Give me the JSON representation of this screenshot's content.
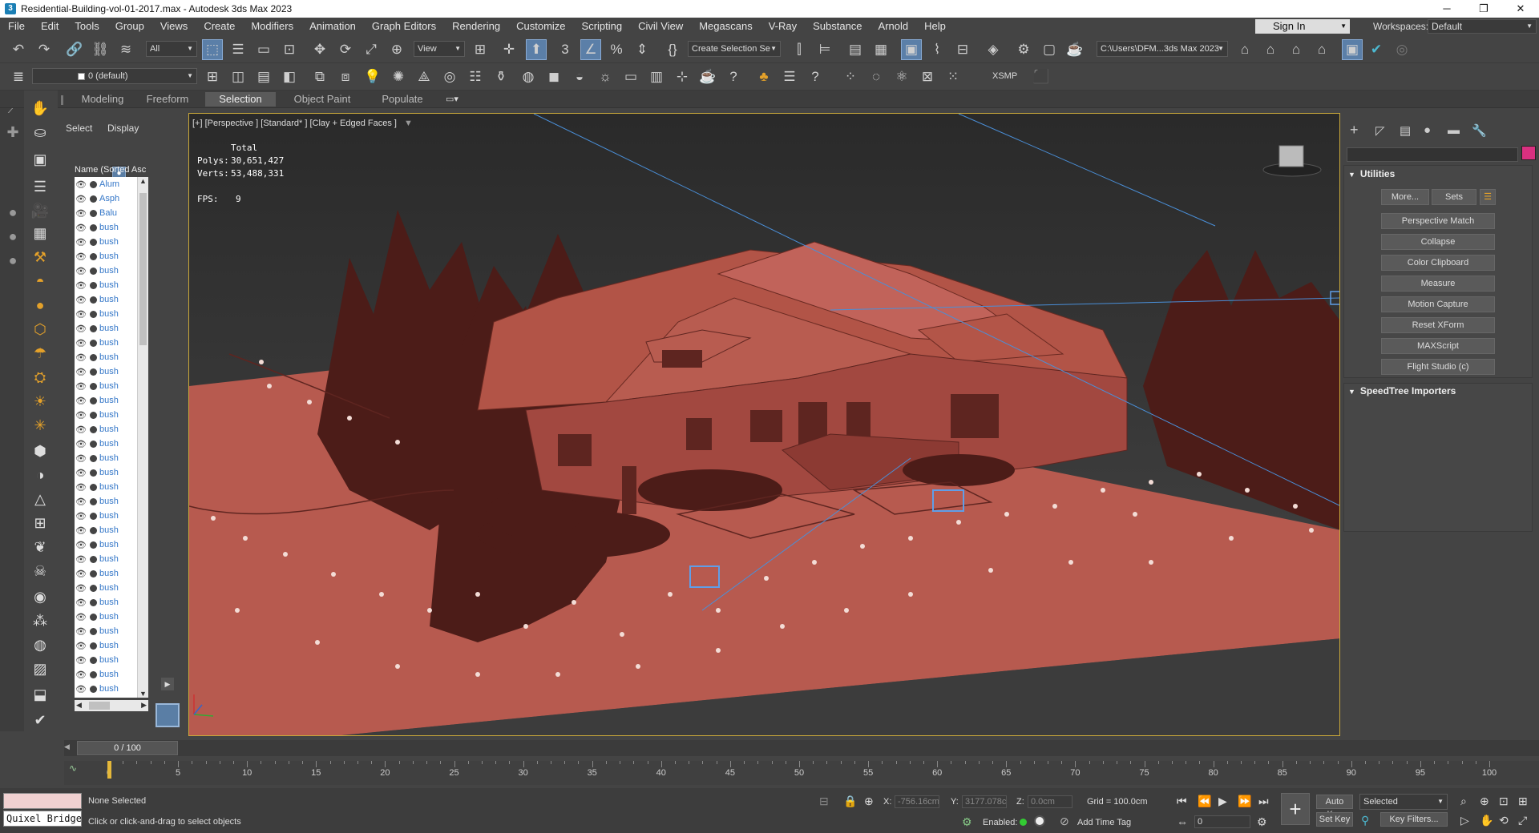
{
  "window": {
    "title": "Residential-Building-vol-01-2017.max - Autodesk 3ds Max 2023"
  },
  "menu": [
    "File",
    "Edit",
    "Tools",
    "Group",
    "Views",
    "Create",
    "Modifiers",
    "Animation",
    "Graph Editors",
    "Rendering",
    "Customize",
    "Scripting",
    "Civil View",
    "Megascans",
    "V-Ray",
    "Substance",
    "Arnold",
    "Help"
  ],
  "account": {
    "sign_in": "Sign In",
    "workspaces_label": "Workspaces:",
    "workspace_value": "Default"
  },
  "toolbar": {
    "selection_filter": "All",
    "reference_coord": "View",
    "selection_set": "Create Selection Se",
    "project_path": "C:\\Users\\DFM...3ds Max 2023",
    "layer": "0 (default)",
    "xsmp": "XSMP"
  },
  "ribbon_tabs": [
    "Modeling",
    "Freeform",
    "Selection",
    "Object Paint",
    "Populate"
  ],
  "explorer": {
    "tab_select": "Select",
    "tab_display": "Display",
    "column_header": "Name (Sorted Asc",
    "items": [
      "Alum",
      "Asph",
      "Balu",
      "bush",
      "bush",
      "bush",
      "bush",
      "bush",
      "bush",
      "bush",
      "bush",
      "bush",
      "bush",
      "bush",
      "bush",
      "bush",
      "bush",
      "bush",
      "bush",
      "bush",
      "bush",
      "bush",
      "bush",
      "bush",
      "bush",
      "bush",
      "bush",
      "bush",
      "bush",
      "bush",
      "bush",
      "bush",
      "bush",
      "bush",
      "bush",
      "bush"
    ]
  },
  "viewport": {
    "label": "[+] [Perspective ] [Standard* ] [Clay + Edged Faces ]",
    "stats": {
      "total_label": "Total",
      "polys_label": "Polys:",
      "polys_value": "30,651,427",
      "verts_label": "Verts:",
      "verts_value": "53,488,331",
      "fps_label": "FPS:",
      "fps_value": "9"
    }
  },
  "command_panel": {
    "utilities_title": "Utilities",
    "more_button": "More...",
    "sets_button": "Sets",
    "utilities": [
      "Perspective Match",
      "Collapse",
      "Color Clipboard",
      "Measure",
      "Motion Capture",
      "Reset XForm",
      "MAXScript",
      "Flight Studio (c)"
    ],
    "speedtree_title": "SpeedTree Importers",
    "object_color": "#d93080"
  },
  "timeline": {
    "frame_display": "0 / 100",
    "ticks": [
      0,
      5,
      10,
      15,
      20,
      25,
      30,
      35,
      40,
      45,
      50,
      55,
      60,
      65,
      70,
      75,
      80,
      85,
      90,
      95,
      100
    ],
    "current_frame": 0
  },
  "status": {
    "quixel": "Quixel Bridge",
    "selection": "None Selected",
    "prompt": "Click or click-and-drag to select objects",
    "x_label": "X:",
    "x_value": "-756.16cm",
    "y_label": "Y:",
    "y_value": "3177.078cm",
    "z_label": "Z:",
    "z_value": "0.0cm",
    "grid": "Grid = 100.0cm",
    "enabled_label": "Enabled:",
    "add_time_tag": "Add Time Tag",
    "auto_key": "Auto Key",
    "set_key": "Set Key",
    "key_mode": "Selected",
    "key_filters": "Key Filters...",
    "frame_field": "0"
  }
}
